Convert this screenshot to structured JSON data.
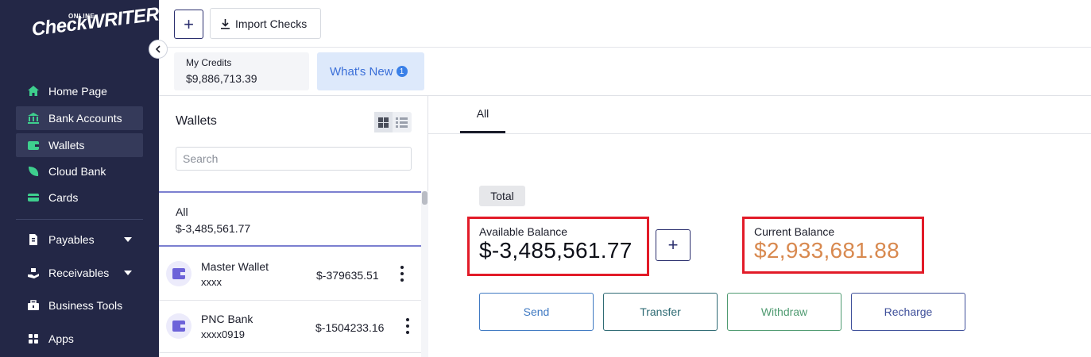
{
  "brand": {
    "small": "ONLINE",
    "main": "CheckWRITER"
  },
  "sidebar": {
    "items": [
      {
        "label": "Home Page",
        "icon": "home-icon"
      },
      {
        "label": "Bank Accounts",
        "icon": "bank-icon"
      },
      {
        "label": "Wallets",
        "icon": "wallet-icon"
      },
      {
        "label": "Cloud Bank",
        "icon": "leaf-icon"
      },
      {
        "label": "Cards",
        "icon": "card-icon"
      },
      {
        "label": "Payables",
        "icon": "document-icon"
      },
      {
        "label": "Receivables",
        "icon": "hand-money-icon"
      },
      {
        "label": "Business Tools",
        "icon": "toolbox-icon"
      },
      {
        "label": "Apps",
        "icon": "grid-icon"
      }
    ]
  },
  "toolbar": {
    "add_label": "+",
    "import_label": "Import Checks"
  },
  "credits": {
    "label": "My Credits",
    "value": "$9,886,713.39"
  },
  "whats_new": {
    "label": "What's New",
    "count": "1"
  },
  "wallets": {
    "title": "Wallets",
    "search_placeholder": "Search",
    "all": {
      "name": "All",
      "amount": "$-3,485,561.77"
    },
    "rows": [
      {
        "name": "Master Wallet",
        "number": "xxxx",
        "amount": "$-379635.51"
      },
      {
        "name": "PNC Bank",
        "number": "xxxx0919",
        "amount": "$-1504233.16"
      }
    ]
  },
  "main": {
    "tab": "All",
    "total_label": "Total",
    "available": {
      "label": "Available Balance",
      "value": "$-3,485,561.77"
    },
    "current": {
      "label": "Current Balance",
      "value": "$2,933,681.88"
    },
    "add_label": "+",
    "actions": {
      "send": "Send",
      "transfer": "Transfer",
      "withdraw": "Withdraw",
      "recharge": "Recharge"
    }
  },
  "colors": {
    "sidebar_bg": "#232746",
    "accent_green": "#3ecf8e",
    "highlight_red": "#e21b28",
    "current_balance": "#d8894f",
    "whats_new_bg": "#dde9fb"
  }
}
